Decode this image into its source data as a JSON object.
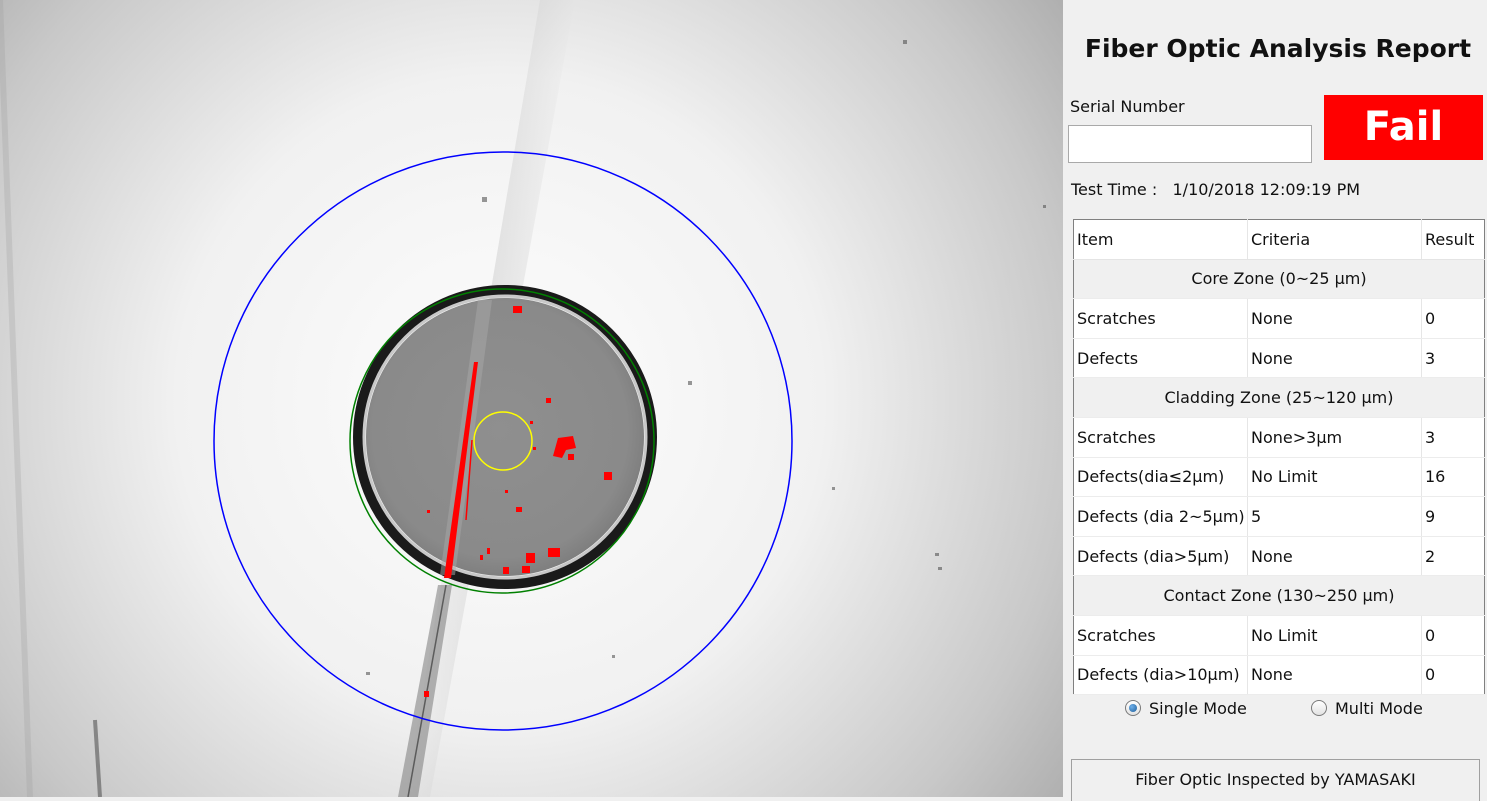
{
  "report": {
    "title": "Fiber Optic Analysis Report",
    "serial_label": "Serial Number",
    "serial_value": "",
    "status": "Fail",
    "status_color": "#ff0000",
    "test_time_label": "Test Time :",
    "test_time_value": "1/10/2018 12:09:19 PM"
  },
  "table": {
    "headers": [
      "Item",
      "Criteria",
      "Result"
    ],
    "sections": [
      {
        "zone": "Core Zone (0~25 μm)",
        "rows": [
          [
            "Scratches",
            "None",
            "0"
          ],
          [
            "Defects",
            "None",
            "3"
          ]
        ]
      },
      {
        "zone": "Cladding Zone (25~120 μm)",
        "rows": [
          [
            "Scratches",
            "None>3μm",
            "3"
          ],
          [
            "Defects(dia≤2μm)",
            "No Limit",
            "16"
          ],
          [
            "Defects (dia 2~5μm)",
            "5",
            "9"
          ],
          [
            "Defects (dia>5μm)",
            "None",
            "2"
          ]
        ]
      },
      {
        "zone": "Contact Zone (130~250 μm)",
        "rows": [
          [
            "Scratches",
            "No Limit",
            "0"
          ],
          [
            "Defects (dia>10μm)",
            "None",
            "0"
          ]
        ]
      }
    ]
  },
  "mode": {
    "options": [
      "Single Mode",
      "Multi Mode"
    ],
    "selected": "Single Mode"
  },
  "footer": "Fiber Optic Inspected by YAMASAKI",
  "overlay_colors": {
    "contact_zone": "#0000ff",
    "cladding_zone": "#008000",
    "core_zone": "#ffff00",
    "defects": "#ff0000"
  }
}
